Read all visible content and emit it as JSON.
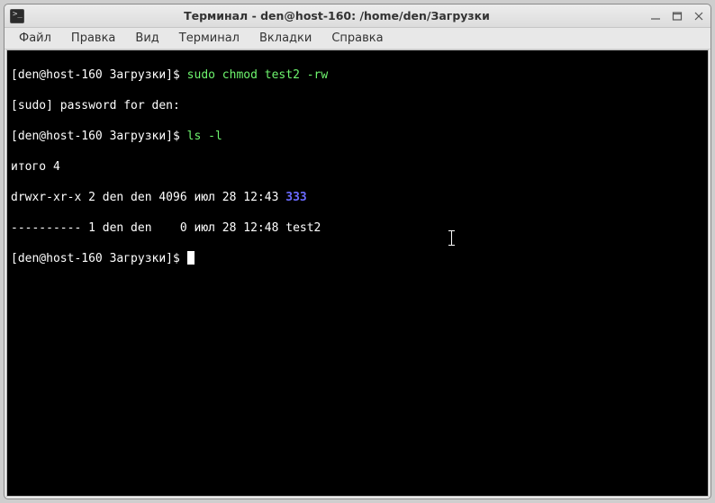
{
  "window": {
    "title": "Терминал - den@host-160: /home/den/Загрузки"
  },
  "menu": {
    "file": "Файл",
    "edit": "Правка",
    "view": "Вид",
    "terminal": "Терминал",
    "tabs": "Вкладки",
    "help": "Справка"
  },
  "term": {
    "l1_prompt": "[den@host-160 Загрузки]$ ",
    "l1_cmd": "sudo chmod test2 -rw",
    "l2": "[sudo] password for den: ",
    "l3_prompt": "[den@host-160 Загрузки]$ ",
    "l3_cmd": "ls -l",
    "l4": "итого 4",
    "l5_pre": "drwxr-xr-x 2 den den 4096 июл 28 12:43 ",
    "l5_dir": "333",
    "l6": "---------- 1 den den    0 июл 28 12:48 test2",
    "l7_prompt": "[den@host-160 Загрузки]$ "
  }
}
